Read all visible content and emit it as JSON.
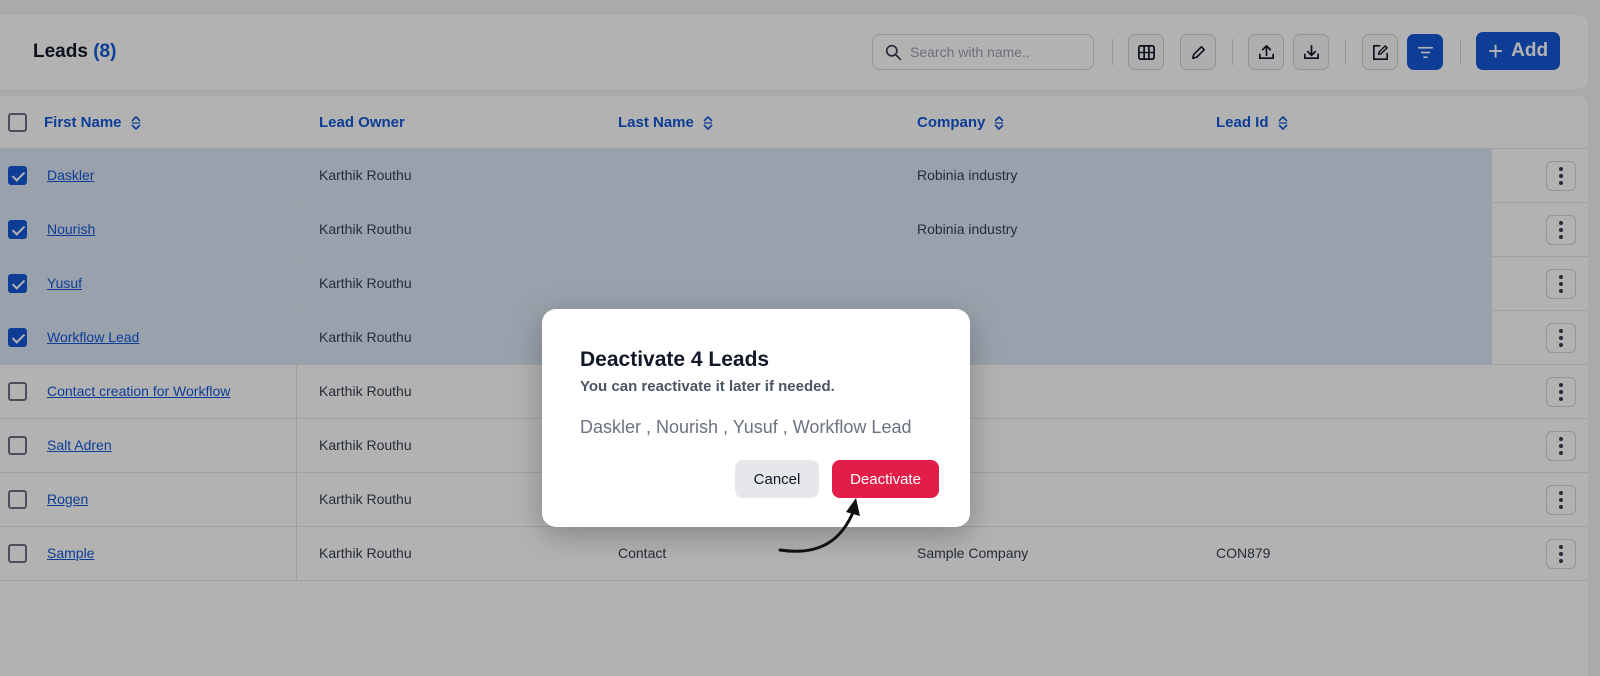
{
  "header": {
    "title": "Leads",
    "count": "(8)",
    "search_placeholder": "Search with name..",
    "add_label": "Add",
    "toolbar_icons": [
      "columns-icon",
      "edit-icon",
      "upload-icon",
      "download-icon",
      "edit-note-icon",
      "filter-icon"
    ]
  },
  "table": {
    "columns": [
      "First Name",
      "Lead Owner",
      "Last Name",
      "Company",
      "Lead Id"
    ],
    "rows": [
      {
        "first_name": "Daskler",
        "lead_owner": "Karthik Routhu",
        "last_name": "",
        "company": "Robinia industry",
        "lead_id": "",
        "checked": true
      },
      {
        "first_name": "Nourish",
        "lead_owner": "Karthik Routhu",
        "last_name": "",
        "company": "Robinia industry",
        "lead_id": "",
        "checked": true
      },
      {
        "first_name": "Yusuf",
        "lead_owner": "Karthik Routhu",
        "last_name": "",
        "company": "",
        "lead_id": "",
        "checked": true
      },
      {
        "first_name": "Workflow Lead",
        "lead_owner": "Karthik Routhu",
        "last_name": "",
        "company": "",
        "lead_id": "",
        "checked": true
      },
      {
        "first_name": "Contact creation for Workflow",
        "lead_owner": "Karthik Routhu",
        "last_name": "",
        "company": "",
        "lead_id": "",
        "checked": false
      },
      {
        "first_name": "Salt Adren",
        "lead_owner": "Karthik Routhu",
        "last_name": "",
        "company": "",
        "lead_id": "",
        "checked": false
      },
      {
        "first_name": "Rogen",
        "lead_owner": "Karthik Routhu",
        "last_name": "",
        "company": "",
        "lead_id": "",
        "checked": false
      },
      {
        "first_name": "Sample",
        "lead_owner": "Karthik Routhu",
        "last_name": "Contact",
        "company": "Sample Company",
        "lead_id": "CON879",
        "checked": false
      }
    ]
  },
  "modal": {
    "title": "Deactivate 4 Leads",
    "subtitle": "You can reactivate it later if needed.",
    "names": "Daskler , Nourish , Yusuf , Workflow Lead",
    "cancel_label": "Cancel",
    "deactivate_label": "Deactivate"
  },
  "colors": {
    "accent": "#1558d6",
    "danger": "#e11d48",
    "selected_row": "#dbe7f7"
  }
}
